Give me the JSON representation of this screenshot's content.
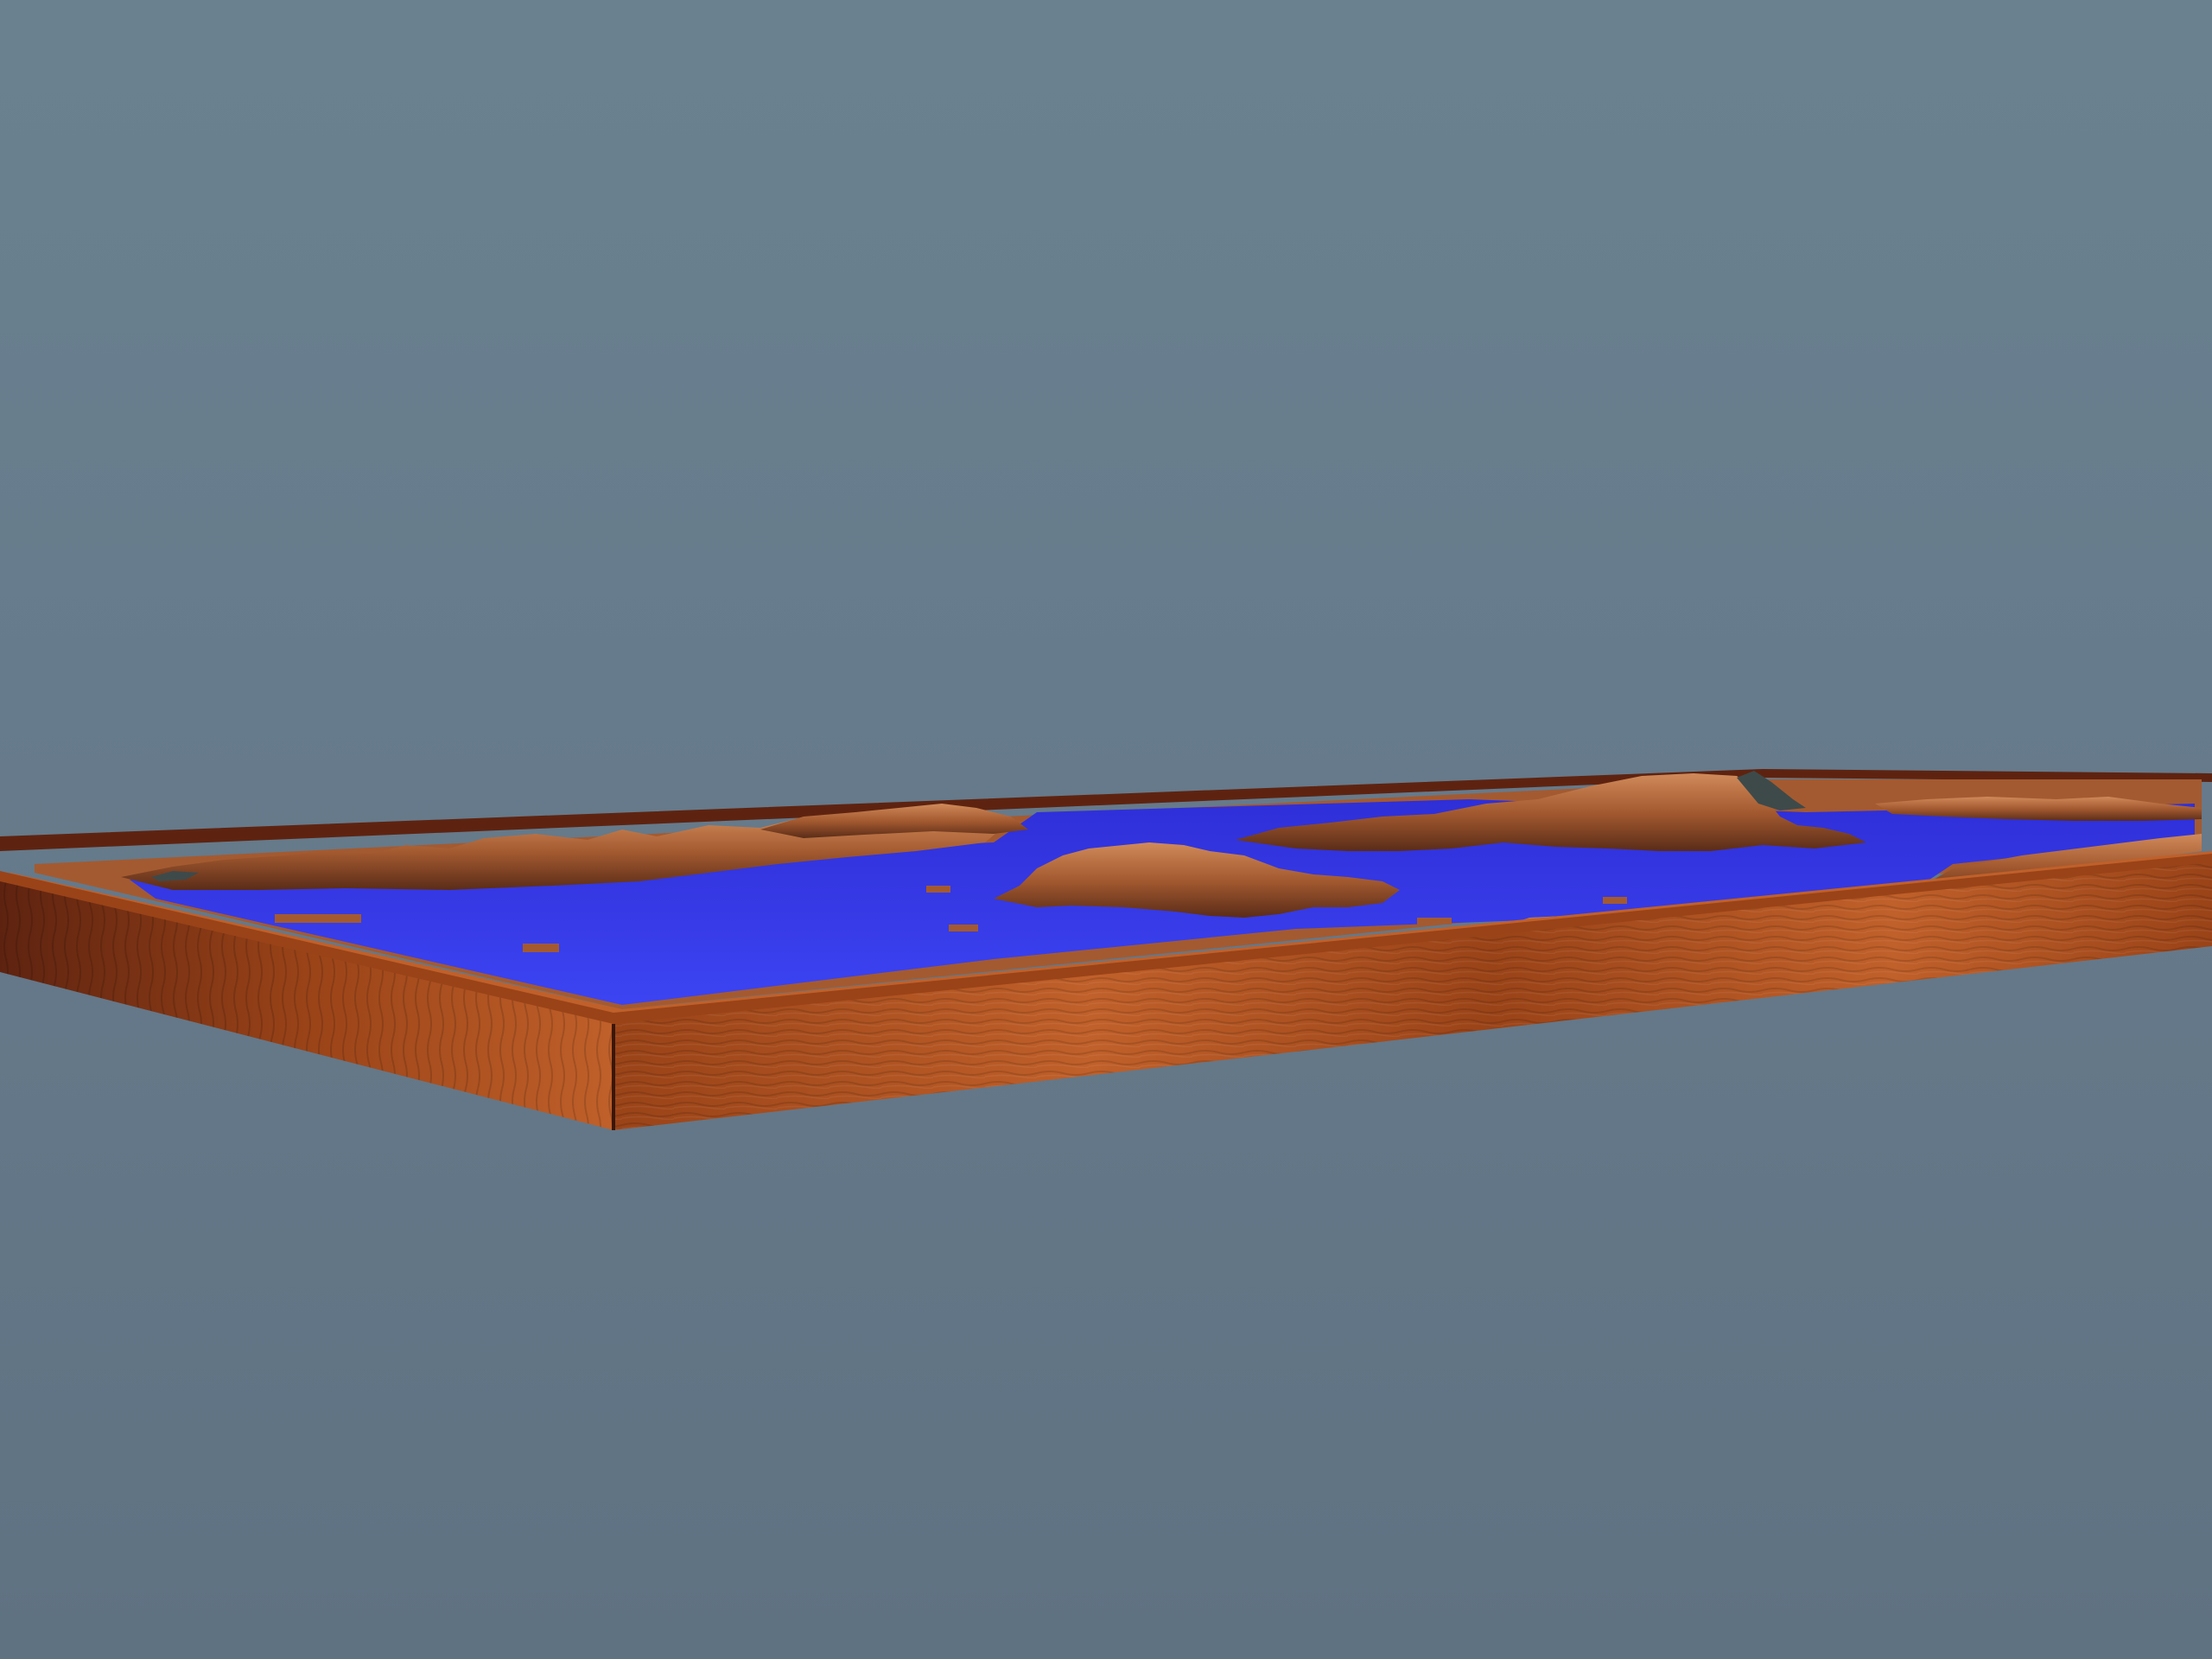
{
  "scene": {
    "subject": "relief-map-tray",
    "colors": {
      "sky_top": "#6a8290",
      "sky_mid": "#65798a",
      "sky_bottom": "#5f7282",
      "water": "#3c44f2",
      "water_deep": "#2f2fd8",
      "wood_light": "#c0602a",
      "wood_mid": "#9a4318",
      "wood_dark": "#5e2310",
      "terrain_light": "#d08a5a",
      "terrain_mid": "#a45a30",
      "terrain_dark": "#5a2c18",
      "snow_rock": "#3e4a4a"
    }
  }
}
